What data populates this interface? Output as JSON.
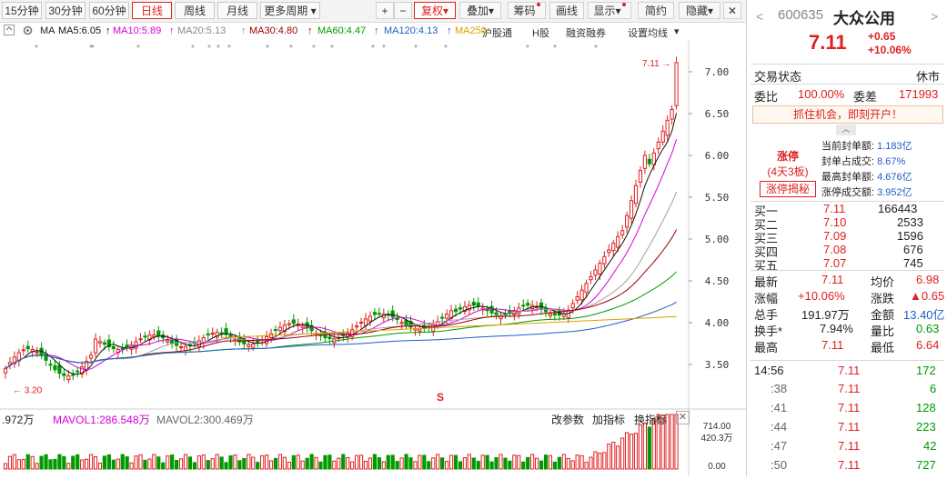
{
  "toolbar": {
    "periods": [
      "15分钟",
      "30分钟",
      "60分钟",
      "日线",
      "周线",
      "月线",
      "更多周期"
    ],
    "active_period": "日线",
    "more_period_arrow": "▾",
    "plus": "+",
    "minus": "−",
    "fuquan": "复权",
    "diejia": "叠加",
    "chouma": "筹码",
    "huaxian": "画线",
    "xianshi": "显示",
    "jianyue": "简约",
    "yincang": "隐藏",
    "close_icon": "✕"
  },
  "ma_legend": {
    "ma": "MA",
    "ma5": "MA5:6.05",
    "ma10": "MA10:5.89",
    "ma20": "MA20:5.13",
    "ma30": "MA30:4.80",
    "ma60": "MA60:4.47",
    "ma120": "MA120:4.13",
    "ma250": "MA250",
    "hugutong": "沪股通",
    "hgu": "H股",
    "rongzi": "融资融券",
    "shezhi": "设置均线"
  },
  "chart_data": {
    "type": "candlestick",
    "y_axis_ticks": [
      "7.00",
      "6.50",
      "6.00",
      "5.50",
      "5.00",
      "4.50",
      "4.00",
      "3.50"
    ],
    "ylim": [
      3.2,
      7.2
    ],
    "high_label": "7.11",
    "low_label": "3.20",
    "volume_ticks": [
      "714.00",
      "420.3万",
      "0.00"
    ],
    "ma_values": {
      "MA5": 6.05,
      "MA10": 5.89,
      "MA20": 5.13,
      "MA30": 4.8,
      "MA60": 4.47,
      "MA120": 4.13
    },
    "colors": {
      "up": "#e02020",
      "down": "#009900",
      "ma5": "#111111",
      "ma10": "#d600d6",
      "ma20": "#a0a0a0",
      "ma30": "#990000",
      "ma60": "#009900",
      "ma120": "#1d5fc6",
      "ma250": "#e0a000"
    }
  },
  "volume_legend": {
    "vol": ".972万",
    "mavol1": "MAVOL1:286.548万",
    "mavol2": "MAVOL2:300.469万",
    "gai": "改参数",
    "jia": "加指标",
    "huan": "换指标"
  },
  "quote": {
    "code": "600635",
    "name": "大众公用",
    "price": "7.11",
    "change": "+0.65",
    "change_pct": "+10.06%",
    "trade_status_label": "交易状态",
    "trade_status": "休市",
    "weibi_label": "委比",
    "weibi": "100.00%",
    "weicha_label": "委差",
    "weicha": "171993",
    "promo": "抓住机会，即刻开户！",
    "zt_title": "涨停",
    "zt_sub": "(4天3板)",
    "zt_button": "涨停揭秘",
    "zt_info": [
      {
        "label": "当前封单额:",
        "value": "1.183亿"
      },
      {
        "label": "封单占成交:",
        "value": "8.67%"
      },
      {
        "label": "最高封单额:",
        "value": "4.676亿"
      },
      {
        "label": "涨停成交额:",
        "value": "3.952亿"
      }
    ],
    "bids": [
      {
        "label": "买一",
        "price": "7.11",
        "vol": "166443"
      },
      {
        "label": "买二",
        "price": "7.10",
        "vol": "2533"
      },
      {
        "label": "买三",
        "price": "7.09",
        "vol": "1596"
      },
      {
        "label": "买四",
        "price": "7.08",
        "vol": "676"
      },
      {
        "label": "买五",
        "price": "7.07",
        "vol": "745"
      }
    ],
    "stats": [
      {
        "l1": "最新",
        "v1": "7.11",
        "l2": "均价",
        "v2": "6.98"
      },
      {
        "l1": "涨幅",
        "v1": "+10.06%",
        "l2": "涨跌",
        "v2": "▲0.65"
      },
      {
        "l1": "总手",
        "v1": "191.97万",
        "l2": "金额",
        "v2": "13.40亿"
      },
      {
        "l1": "换手*",
        "v1": "7.94%",
        "l2": "量比",
        "v2": "0.63"
      },
      {
        "l1": "最高",
        "v1": "7.11",
        "l2": "最低",
        "v2": "6.64"
      }
    ],
    "ticks": [
      {
        "time": "14:56",
        "price": "7.11",
        "vol": "172"
      },
      {
        "time": ":38",
        "price": "7.11",
        "vol": "6"
      },
      {
        "time": ":41",
        "price": "7.11",
        "vol": "128"
      },
      {
        "time": ":44",
        "price": "7.11",
        "vol": "223"
      },
      {
        "time": ":47",
        "price": "7.11",
        "vol": "42"
      },
      {
        "time": ":50",
        "price": "7.11",
        "vol": "727"
      }
    ]
  }
}
